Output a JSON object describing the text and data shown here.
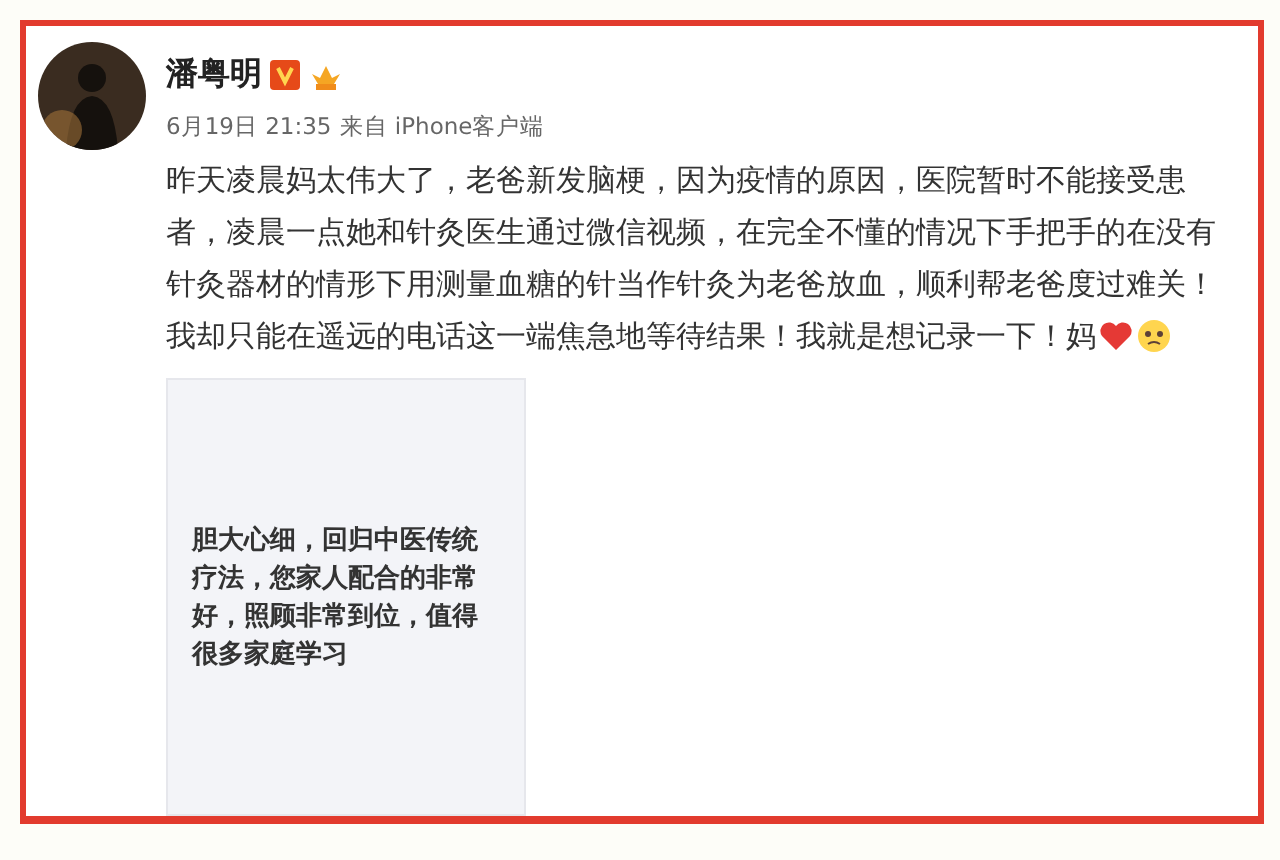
{
  "post": {
    "author": "潘粤明",
    "timestamp": "6月19日 21:35",
    "source": "来自 iPhone客户端",
    "text_lines": [
      "昨天凌晨妈太伟大了，老爸新发脑梗，因为疫情的原因，医院暂时不能接受患",
      "者，凌晨一点她和针灸医生通过微信视频，在完全不懂的情况下手把手的在没有",
      "针灸器材的情形下用测量血糖的针当作针灸为老爸放血，顺利帮老爸度过难关！",
      "我却只能在遥远的电话这一端焦急地等待结果！我就是想记录一下！妈"
    ],
    "image_text": "胆大心细，回归中医传统疗法，您家人配合的非常好，照顾非常到位，值得很多家庭学习"
  }
}
